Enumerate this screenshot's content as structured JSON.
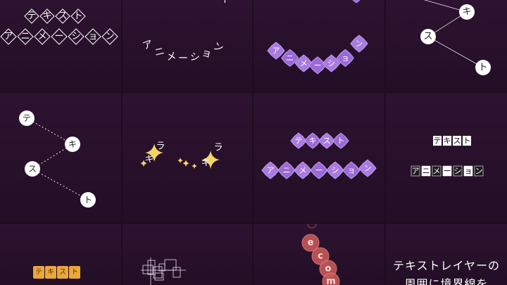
{
  "colors": {
    "background": "#1d0c1e",
    "tile_top": "#2d1330",
    "tile_bottom": "#230e26",
    "purple": "#9b6ad6",
    "purple_light": "#c09cf0",
    "gold": "#e9a83a",
    "spark": "#ffe066",
    "coral": "#c95a5a"
  },
  "tiles": [
    {
      "id": "diamond-title",
      "line1": [
        "テ",
        "キ",
        "ス",
        "ト"
      ],
      "line2": [
        "ア",
        "ニ",
        "メ",
        "ー",
        "シ",
        "ョ",
        "ン"
      ],
      "icon": "diamond-frame-icon"
    },
    {
      "id": "arc-text",
      "chars": [
        "ア",
        "ニ",
        "メ",
        "ー",
        "シ",
        "ョ",
        "ン"
      ],
      "top_fragment": "ト"
    },
    {
      "id": "purple-flower-arc",
      "chars": [
        "ア",
        "ニ",
        "メ",
        "ー",
        "シ",
        "ョ",
        "ン"
      ],
      "icon": "flower-badge-icon"
    },
    {
      "id": "circle-network-top",
      "chars": [
        "キ",
        "ス",
        "ト"
      ],
      "icon": "circle-node-icon"
    },
    {
      "id": "circle-network",
      "chars": [
        "テ",
        "キ",
        "ス",
        "ト"
      ],
      "icon": "circle-node-icon"
    },
    {
      "id": "sparkle-text",
      "chars": [
        "キ",
        "ラ",
        "キ",
        "ラ"
      ],
      "icon": "sparkle-icon"
    },
    {
      "id": "purple-flower-rows",
      "line1": [
        "テ",
        "キ",
        "ス",
        "ト"
      ],
      "line2": [
        "ア",
        "ニ",
        "メ",
        "ー",
        "シ",
        "ョ",
        "ン"
      ],
      "icon": "flower-badge-icon"
    },
    {
      "id": "box-text",
      "line1": [
        "テ",
        "キ",
        "ス",
        "ト"
      ],
      "line2": [
        "ア",
        "ニ",
        "メ",
        "ー",
        "シ",
        "ョ",
        "ン"
      ],
      "icon": "square-box-icon"
    },
    {
      "id": "gold-tags",
      "chars": [
        "テ",
        "キ",
        "ス",
        "ト"
      ],
      "icon": "gold-tag-icon"
    },
    {
      "id": "wireframe-text",
      "icon": "wireframe-box-icon"
    },
    {
      "id": "coral-circles",
      "chars": [
        "e",
        "c",
        "o",
        "m"
      ],
      "icon": "coral-circle-icon"
    },
    {
      "id": "border-caption",
      "line1": "テキストレイヤーの",
      "line2": "周囲に境界線を"
    }
  ]
}
